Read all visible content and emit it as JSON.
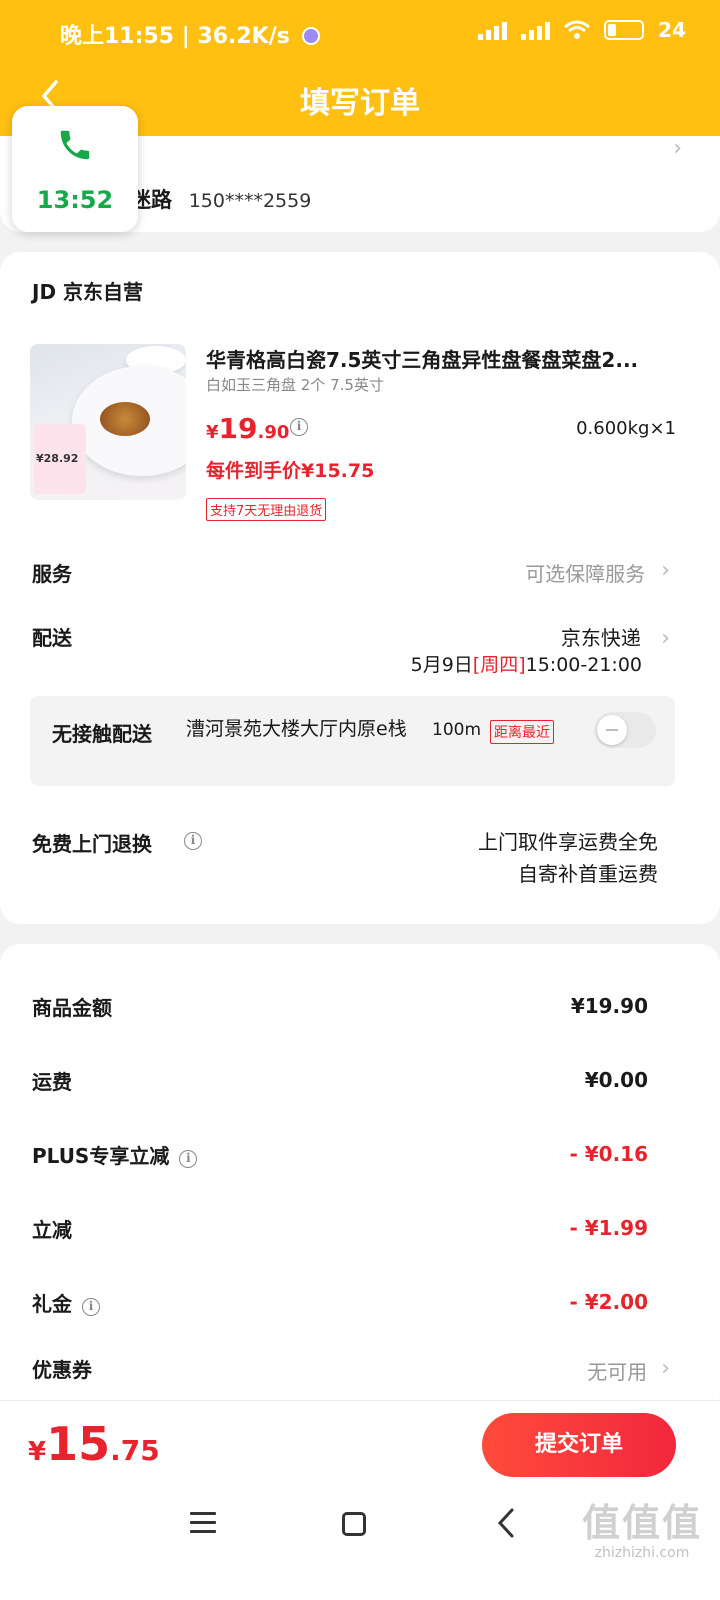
{
  "status_bar": {
    "time": "晚上11:55 | 36.2K/s",
    "battery": "24"
  },
  "header": {
    "title": "填写订单"
  },
  "address": {
    "street": "迷路",
    "phone": "150****2559"
  },
  "call": {
    "duration": "13:52"
  },
  "shop": {
    "name": "JD 京东自营"
  },
  "product": {
    "title": "华青格高白瓷7.5英寸三角盘异性盘餐盘菜盘2...",
    "spec": "白如玉三角盘 2个 7.5英寸",
    "price_symbol": "¥",
    "price_int": "19",
    "price_dec": ".90",
    "weight_qty": "0.600kg×1",
    "unit_price": "每件到手价¥15.75",
    "return_tag": "支持7天无理由退货",
    "image_promo_price": "¥28.92"
  },
  "service": {
    "label": "服务",
    "value": "可选保障服务"
  },
  "delivery": {
    "label": "配送",
    "carrier": "京东快递",
    "date": "5月9日",
    "weekday": "[周四]",
    "window": "15:00-21:00"
  },
  "contactless": {
    "label": "无接触配送",
    "place": "漕河景苑大楼大厅内原e栈",
    "distance": "100m",
    "tag": "距离最近",
    "enabled": false
  },
  "free_return": {
    "label": "免费上门退换",
    "line1": "上门取件享运费全免",
    "line2": "自寄补首重运费"
  },
  "fees": {
    "goods_label": "商品金额",
    "goods_value": "¥19.90",
    "shipping_label": "运费",
    "shipping_value": "¥0.00",
    "plus_label": "PLUS专享立减",
    "plus_value": "- ¥0.16",
    "discount_label": "立减",
    "discount_value": "- ¥1.99",
    "gift_label": "礼金",
    "gift_value": "- ¥2.00",
    "coupon_label": "优惠券",
    "coupon_value": "无可用"
  },
  "footer": {
    "total_symbol": "¥",
    "total_int": "15",
    "total_dec": ".75",
    "submit_label": "提交订单"
  },
  "watermark": {
    "logo": "值值值",
    "url": "zhizhizhi.com"
  },
  "colors": {
    "header": "#ffc012",
    "accent_red": "#e8232d",
    "call_green": "#18a84a"
  },
  "icons": {
    "back": "chevron-left-icon",
    "info": "info-icon",
    "phone": "phone-icon",
    "chevron": "chevron-right-icon"
  }
}
